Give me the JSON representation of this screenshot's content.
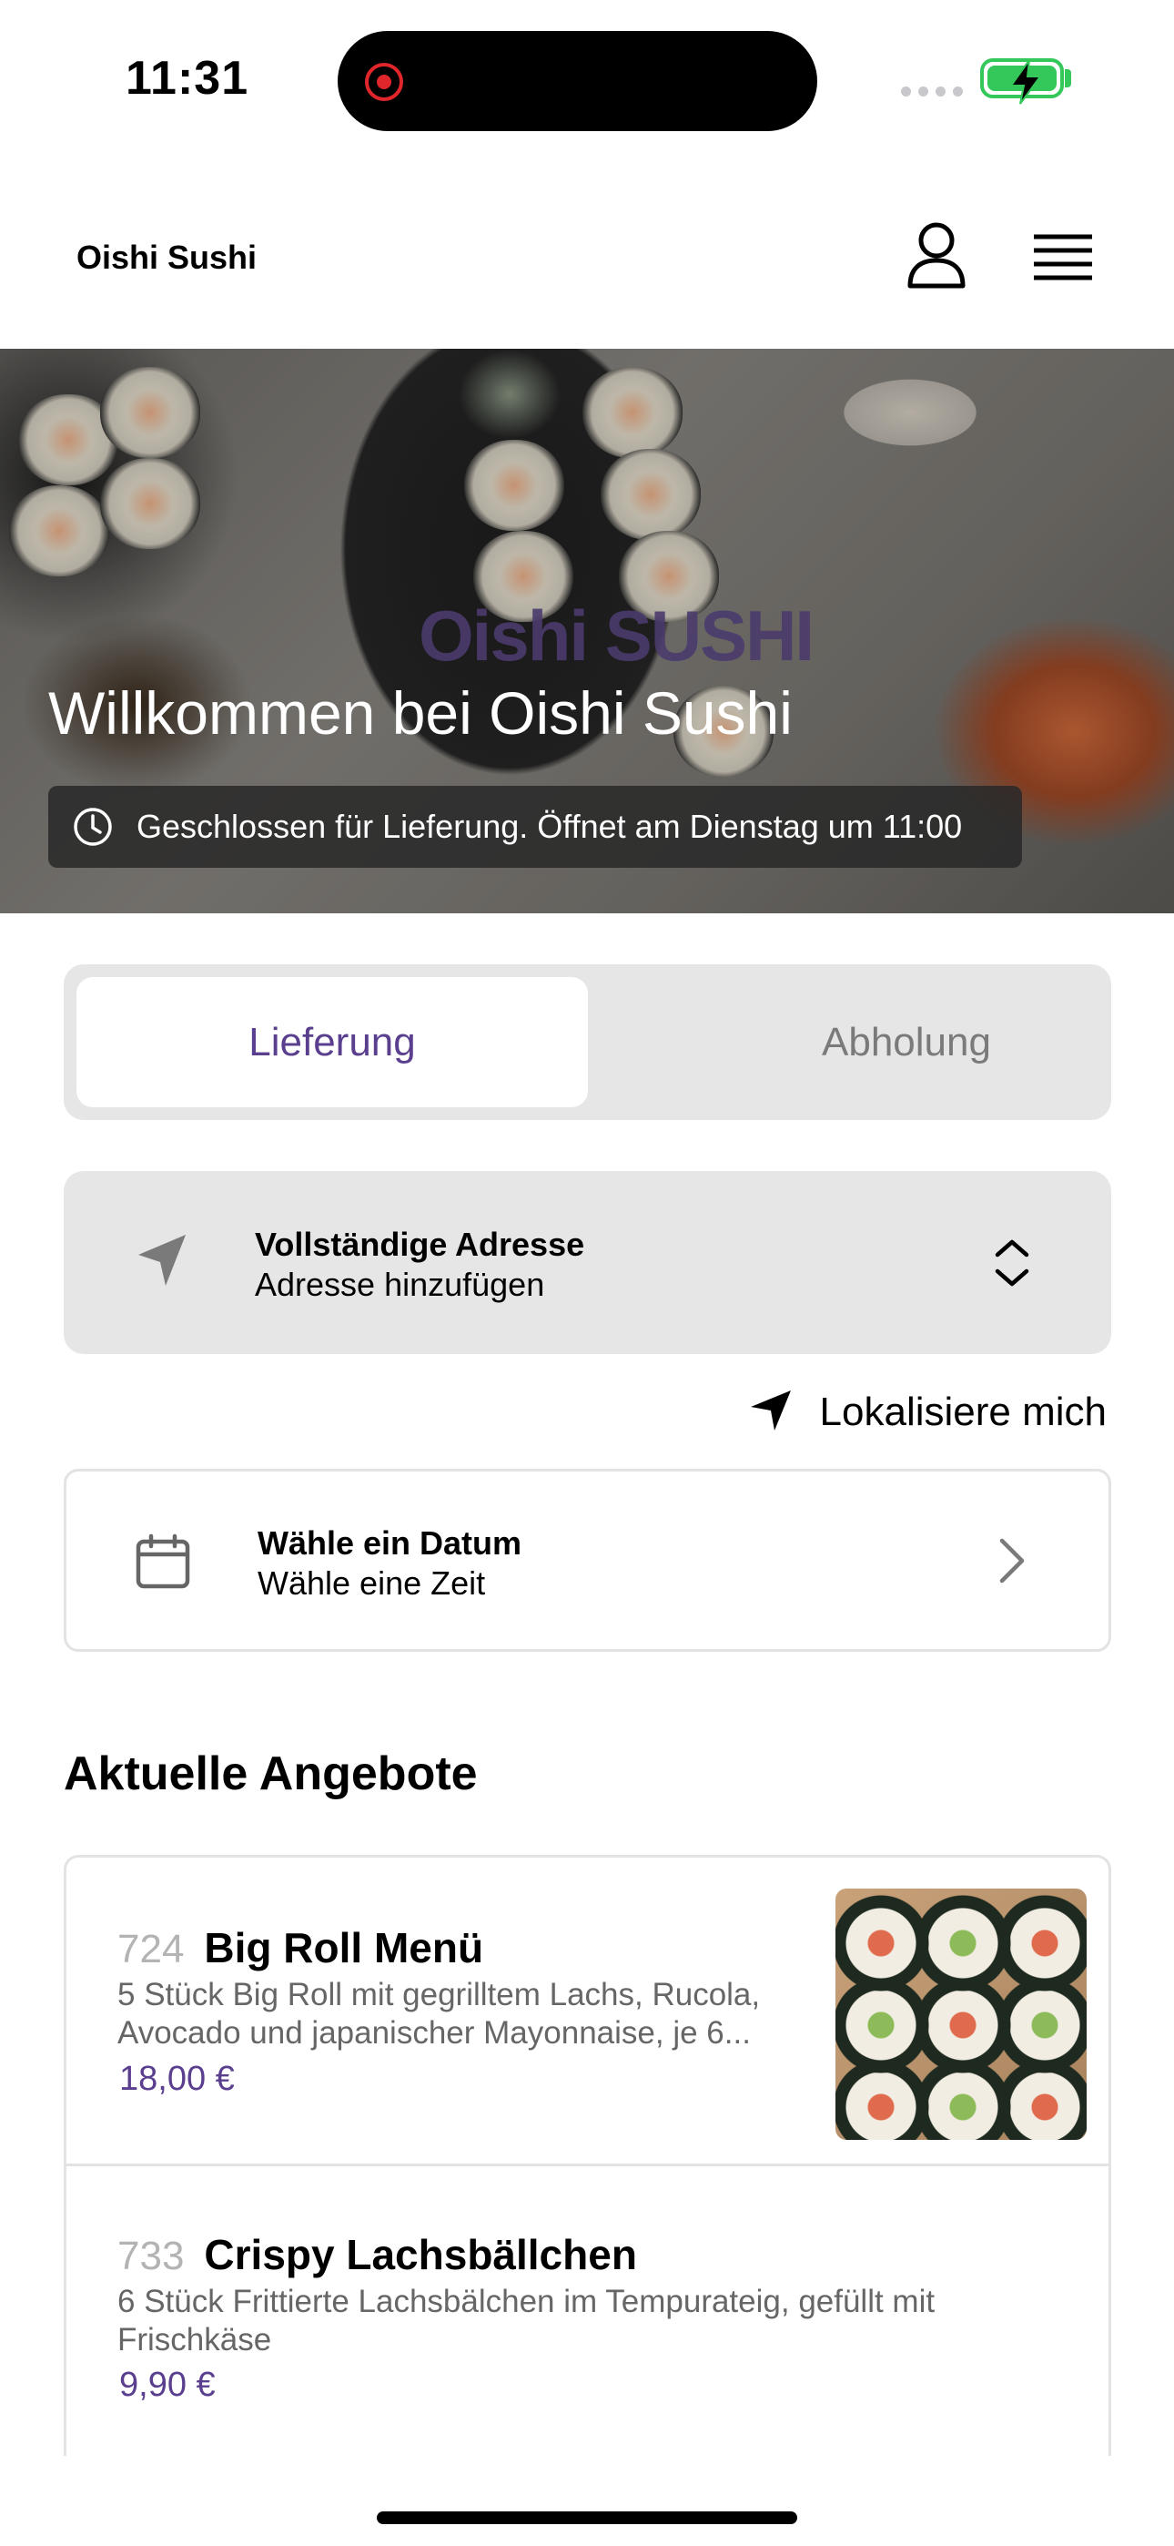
{
  "status_bar": {
    "time": "11:31"
  },
  "header": {
    "brand": "Oishi Sushi"
  },
  "hero": {
    "logo_text": "Oishi SUSHI",
    "title": "Willkommen bei Oishi Sushi",
    "notice": "Geschlossen für Lieferung. Öffnet am Dienstag um 11:00"
  },
  "mode_toggle": {
    "active": "Lieferung",
    "inactive": "Abholung"
  },
  "address": {
    "title": "Vollständige Adresse",
    "subtitle": "Adresse hinzufügen"
  },
  "locate": {
    "label": "Lokalisiere mich"
  },
  "date": {
    "title": "Wähle ein Datum",
    "subtitle": "Wähle eine Zeit"
  },
  "offers": {
    "heading": "Aktuelle Angebote",
    "items": [
      {
        "number": "724",
        "name": "Big Roll Menü",
        "desc_line1": "5 Stück Big Roll mit gegrilltem Lachs, Rucola,",
        "desc_line2": "Avocado und japanischer Mayonnaise, je 6...",
        "price": "18,00 €"
      },
      {
        "number": "733",
        "name": "Crispy Lachsbällchen",
        "desc_line1": "6 Stück Frittierte Lachsbälchen im Tempurateig, gefüllt mit",
        "desc_line2": "Frischkäse",
        "price": "9,90 €"
      }
    ]
  },
  "colors": {
    "accent": "#5b3f8f",
    "panel": "#e6e6e6",
    "battery": "#34c759",
    "recording": "#e0252b"
  },
  "icons": [
    "record-icon",
    "battery-icon",
    "user-icon",
    "menu-icon",
    "clock-icon",
    "navigation-icon",
    "chevron-updown-icon",
    "location-arrow-icon",
    "calendar-icon",
    "chevron-right-icon"
  ]
}
